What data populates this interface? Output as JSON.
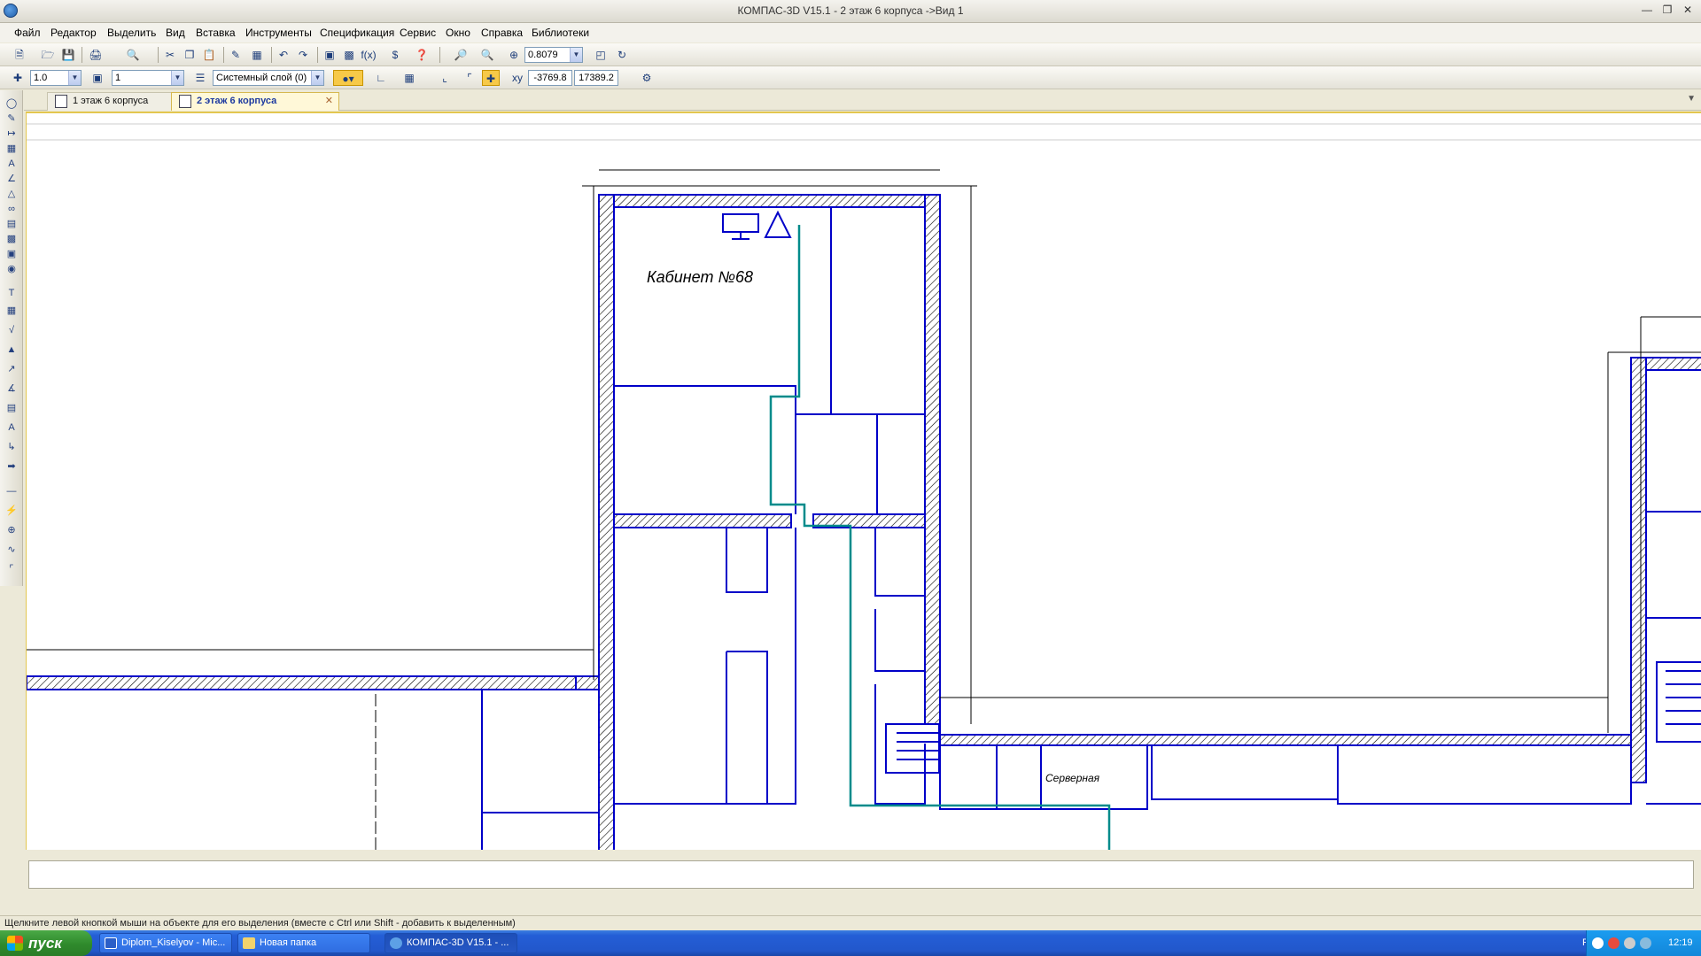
{
  "window": {
    "title": "КОМПАС-3D V15.1 - 2 этаж 6 корпуса ->Вид 1"
  },
  "menu": [
    "Файл",
    "Редактор",
    "Выделить",
    "Вид",
    "Вставка",
    "Инструменты",
    "Спецификация",
    "Сервис",
    "Окно",
    "Справка",
    "Библиотеки"
  ],
  "toolbar": {
    "zoom_value": "0.8079",
    "step_value": "1.0",
    "view_number": "1",
    "layer": "Системный слой (0)",
    "coord_x": "-3769.8",
    "coord_y": "17389.2"
  },
  "tabs": [
    {
      "label": "1 этаж 6 корпуса",
      "active": false
    },
    {
      "label": "2 этаж 6 корпуса",
      "active": true
    }
  ],
  "drawing": {
    "room_label": "Кабинет №68",
    "server_label": "Серверная",
    "wall_color": "#0000c8",
    "cable_color": "#008b8b"
  },
  "status": {
    "hint": "Щелкните левой кнопкой мыши на объекте для его выделения (вместе с Ctrl или Shift - добавить к выделенным)"
  },
  "taskbar": {
    "start_label": "пуск",
    "tasks": [
      {
        "label": "Diplom_Kiselyov - Mic...",
        "icon": "word-icon"
      },
      {
        "label": "Новая папка",
        "icon": "folder-icon"
      },
      {
        "label": "КОМПАС-3D V15.1 - ...",
        "icon": "kompas-icon"
      }
    ],
    "language": "RU",
    "clock": "12:19"
  }
}
